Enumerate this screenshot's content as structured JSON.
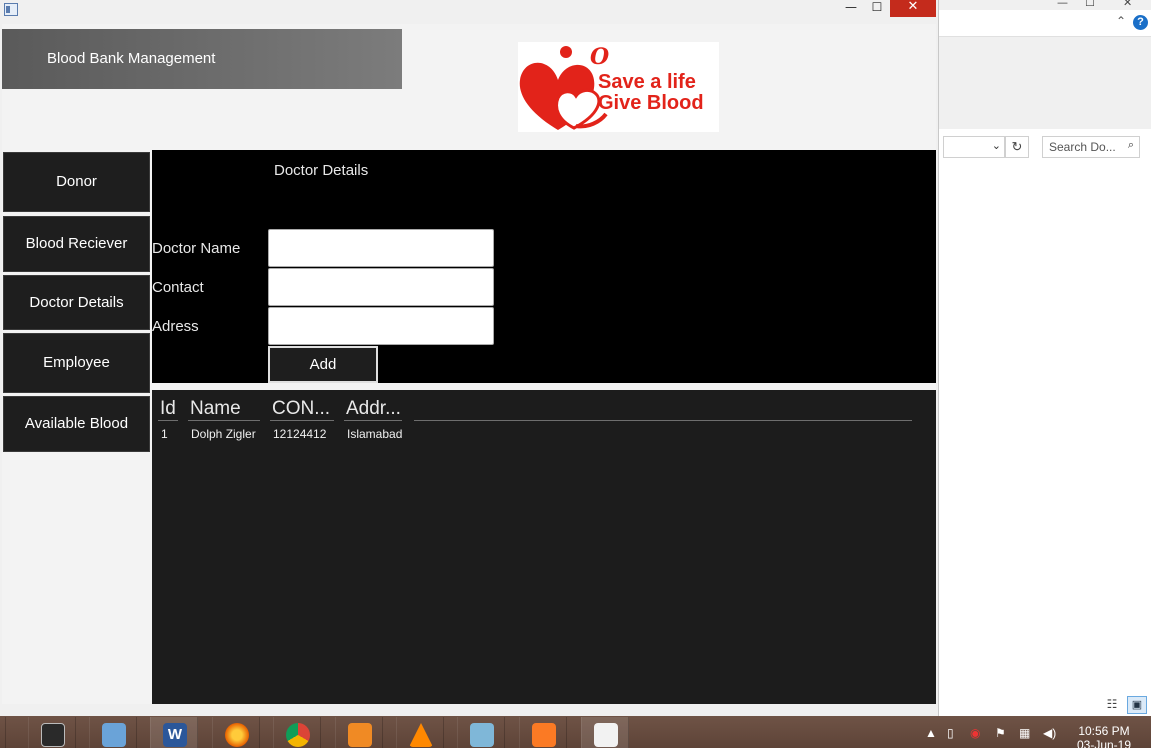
{
  "window": {
    "minimize_glyph": "—",
    "maximize_glyph": "☐",
    "close_glyph": "✕"
  },
  "header": {
    "title": "Blood Bank Management",
    "logo_line1": "Save a life",
    "logo_line2": "Give Blood",
    "logo_mark": "O"
  },
  "sidebar": {
    "items": [
      {
        "label": "Donor"
      },
      {
        "label": "Blood Reciever"
      },
      {
        "label": "Doctor Details"
      },
      {
        "label": "Employee"
      },
      {
        "label": "Available Blood"
      }
    ]
  },
  "form": {
    "title": "Doctor  Details",
    "name_label": "Doctor Name",
    "contact_label": "Contact",
    "address_label": "Adress",
    "name_value": "",
    "contact_value": "",
    "address_value": "",
    "add_label": "Add"
  },
  "table": {
    "columns": [
      "Id",
      "Name",
      "CON...",
      "Addr..."
    ],
    "rows": [
      [
        "1",
        "Dolph Zigler",
        "12124412",
        "Islamabad"
      ]
    ]
  },
  "background_window": {
    "search_placeholder": "Search Do...",
    "help_glyph": "?",
    "chevron_up": "⌃",
    "refresh_glyph": "↻",
    "dropdown_glyph": "⌄",
    "search_glyph": "⌕"
  },
  "taskbar": {
    "apps": [
      {
        "icon": "media-player-classic-icon"
      },
      {
        "icon": "virtualbox-icon"
      },
      {
        "icon": "word-icon"
      },
      {
        "icon": "firefox-icon"
      },
      {
        "icon": "chrome-icon"
      },
      {
        "icon": "uc-browser-icon"
      },
      {
        "icon": "vlc-icon"
      },
      {
        "icon": "app-icon"
      },
      {
        "icon": "xampp-icon"
      },
      {
        "icon": "java-icon"
      }
    ],
    "time": "10:56 PM",
    "date": "03-Jun-19"
  },
  "colors": {
    "accent_red": "#e2231a",
    "panel_black": "#000000",
    "table_bg": "#1c1c1c",
    "nav_bg": "#1e1e1e",
    "banner_grey": "#6b6b6b",
    "taskbar": "#644a3d",
    "close_red": "#c42b1c"
  }
}
